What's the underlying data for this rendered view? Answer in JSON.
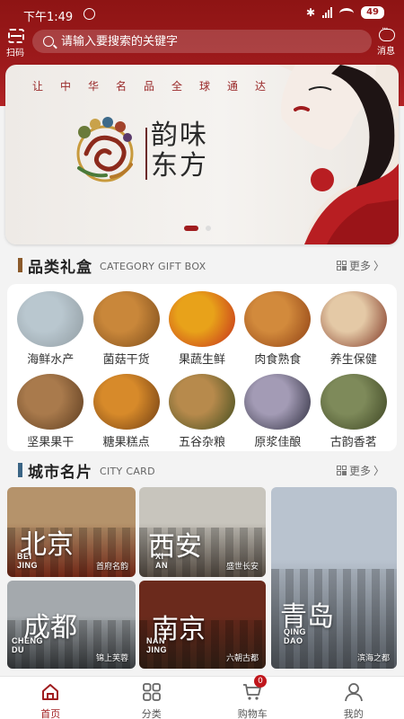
{
  "status": {
    "time": "下午1:49",
    "battery": "49"
  },
  "header": {
    "scan_label": "扫码",
    "search_placeholder": "请输入要搜索的关键字",
    "message_label": "消息"
  },
  "banner": {
    "motto": "让中华名品全球通达",
    "brand": "韵味东方",
    "dots": 2,
    "active_dot": 0
  },
  "category": {
    "title": "品类礼盒",
    "subtitle": "CATEGORY GIFT BOX",
    "more": "更多",
    "items": [
      {
        "label": "海鲜水产",
        "colors": [
          "#b9c7cf",
          "#8f9aa0"
        ]
      },
      {
        "label": "菌菇干货",
        "colors": [
          "#c9873a",
          "#7a4a1a"
        ]
      },
      {
        "label": "果蔬生鲜",
        "colors": [
          "#e8a21a",
          "#c42a1c"
        ]
      },
      {
        "label": "肉食熟食",
        "colors": [
          "#d28a3c",
          "#8c3d12"
        ]
      },
      {
        "label": "养生保健",
        "colors": [
          "#e4c9a6",
          "#7b2f1e"
        ]
      },
      {
        "label": "坚果果干",
        "colors": [
          "#a97a4c",
          "#5a3a1e"
        ]
      },
      {
        "label": "糖果糕点",
        "colors": [
          "#d78a2a",
          "#6b3a12"
        ]
      },
      {
        "label": "五谷杂粮",
        "colors": [
          "#b78a4c",
          "#3c4a1c"
        ]
      },
      {
        "label": "原浆佳酿",
        "colors": [
          "#a39bb5",
          "#2a2a3a"
        ]
      },
      {
        "label": "古韵香茗",
        "colors": [
          "#7e8a5a",
          "#3a4220"
        ]
      }
    ]
  },
  "city": {
    "title": "城市名片",
    "subtitle": "CITY CARD",
    "more": "更多",
    "cards": [
      {
        "name": "北京",
        "pinyin1": "BEI",
        "pinyin2": "JING",
        "tag": "首府名韵",
        "sky": "#b5936b",
        "ground": "#7a2a18"
      },
      {
        "name": "西安",
        "pinyin1": "XI",
        "pinyin2": "AN",
        "tag": "盛世长安",
        "sky": "#c8c5bd",
        "ground": "#5a5046"
      },
      {
        "name": "青岛",
        "pinyin1": "QING",
        "pinyin2": "DAO",
        "tag": "滨海之都",
        "sky": "#b9c3cf",
        "ground": "#595f66"
      },
      {
        "name": "成都",
        "pinyin1": "CHENG",
        "pinyin2": "DU",
        "tag": "锦上芙蓉",
        "sky": "#a4a9ad",
        "ground": "#3d4144"
      },
      {
        "name": "南京",
        "pinyin1": "NAN",
        "pinyin2": "JING",
        "tag": "六朝古都",
        "sky": "#6b2a1c",
        "ground": "#3a2418"
      }
    ]
  },
  "nav": {
    "items": [
      {
        "label": "首页",
        "icon": "home-icon"
      },
      {
        "label": "分类",
        "icon": "grid-icon"
      },
      {
        "label": "购物车",
        "icon": "cart-icon"
      },
      {
        "label": "我的",
        "icon": "user-icon"
      }
    ],
    "cart_count": "0"
  },
  "colors": {
    "primary": "#9d1a1c",
    "accent_bar_category": "#8b5a2b",
    "accent_bar_city": "#3b6585"
  }
}
